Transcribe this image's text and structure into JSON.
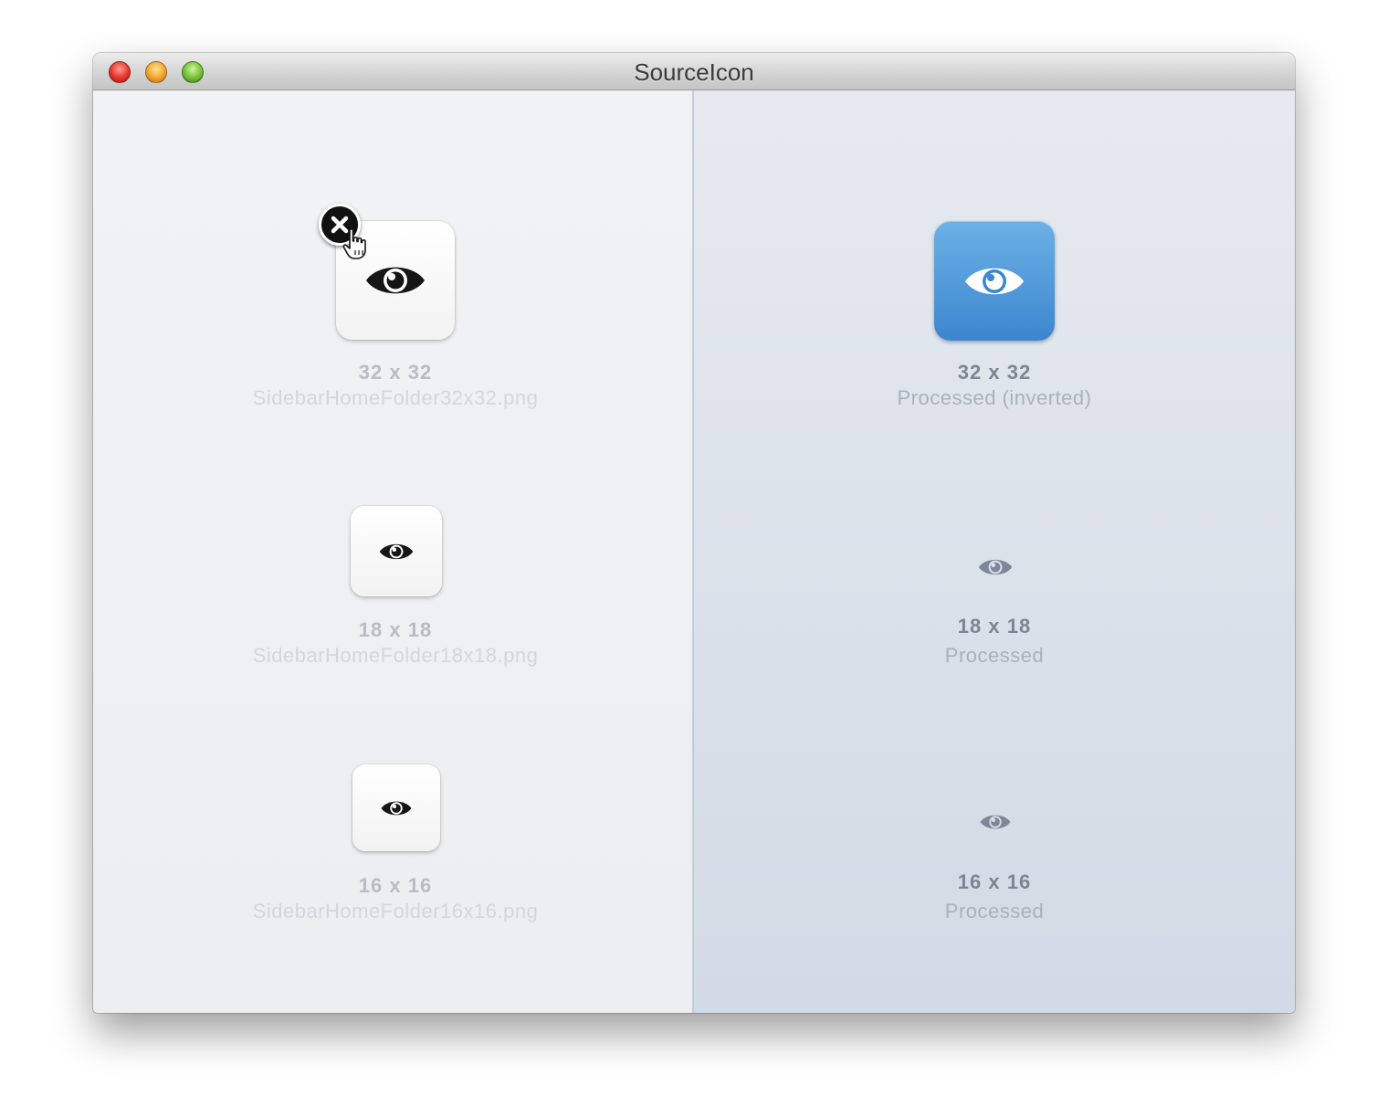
{
  "window": {
    "title": "SourceIcon"
  },
  "source": {
    "items": [
      {
        "size": "32 x 32",
        "filename": "SidebarHomeFolder32x32.png"
      },
      {
        "size": "18 x 18",
        "filename": "SidebarHomeFolder18x18.png"
      },
      {
        "size": "16 x 16",
        "filename": "SidebarHomeFolder16x16.png"
      }
    ]
  },
  "processed": {
    "items": [
      {
        "size": "32 x 32",
        "caption": "Processed (inverted)"
      },
      {
        "size": "18 x 18",
        "caption": "Processed"
      },
      {
        "size": "16 x 16",
        "caption": "Processed"
      }
    ]
  },
  "icons": {
    "source": "eye-icon",
    "remove": "close-circle-icon",
    "cursor": "pointing-hand-cursor"
  },
  "colors": {
    "accent_blue": "#3b86cf",
    "processed_icon_gray": "#7d8797"
  }
}
